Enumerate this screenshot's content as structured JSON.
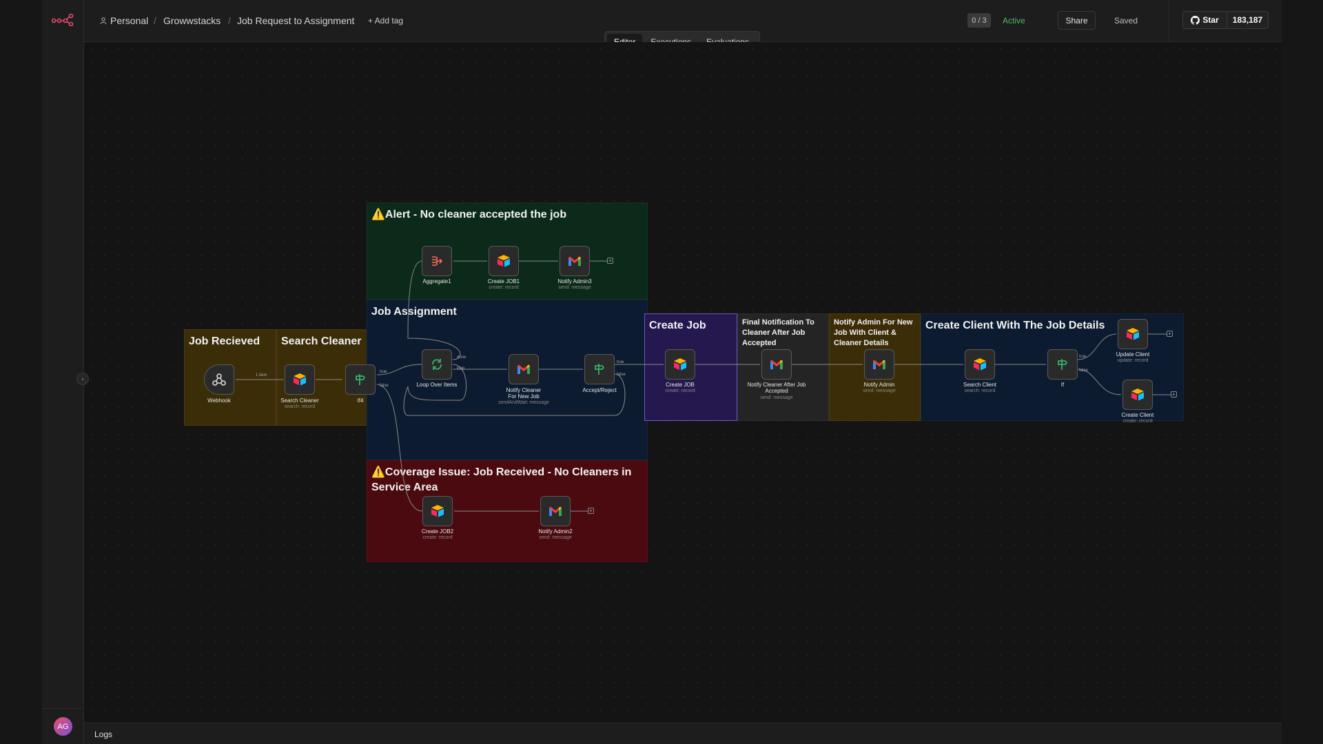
{
  "topbar": {
    "breadcrumb": {
      "personal": "Personal",
      "project": "Growwstacks",
      "workflow": "Job Request to Assignment"
    },
    "add_tag": "+ Add tag",
    "counter": "0 / 3",
    "active": "Active",
    "share": "Share",
    "saved": "Saved",
    "github": {
      "star": "Star",
      "count": "183,187"
    }
  },
  "tabs": {
    "editor": "Editor",
    "executions": "Executions",
    "evaluations": "Evaluations"
  },
  "sidebar": {
    "avatar": "AG"
  },
  "logs": "Logs",
  "colors": {
    "accent": "#ea4b71",
    "active": "#4fb96f",
    "airtable": "#2d7ff9",
    "gmail": "#ea4335",
    "if": "#35b36a"
  },
  "stickies": {
    "job_received": "Job Recieved",
    "search_cleaner": "Search Cleaner",
    "alert": "⚠️Alert - No cleaner accepted the job",
    "job_assignment": "Job Assignment",
    "coverage": "⚠️Coverage Issue: Job Received - No Cleaners in Service Area",
    "create_job": "Create Job",
    "final_notification": "Final Notification To Cleaner After Job Accepted",
    "notify_admin": "Notify Admin For New Job With Client & Cleaner Details",
    "create_client": "Create Client With The Job Details"
  },
  "nodes": {
    "webhook": {
      "label": "Webhook"
    },
    "search_cleaner": {
      "label": "Search Cleaner",
      "sub": "search: record"
    },
    "if4": {
      "label": "If4"
    },
    "aggregate1": {
      "label": "Aggregate1"
    },
    "create_job1": {
      "label": "Create JOB1",
      "sub": "create: record"
    },
    "notify_admin3": {
      "label": "Notify Admin3",
      "sub": "send: message"
    },
    "loop": {
      "label": "Loop Over Items"
    },
    "notify_cleaner": {
      "label": "Notify Cleaner For New Job",
      "sub": "sendAndWait: message"
    },
    "accept_reject": {
      "label": "Accept/Reject"
    },
    "create_job": {
      "label": "Create JOB",
      "sub": "create: record"
    },
    "notify_cleaner_after": {
      "label": "Notify Cleaner After Job Accepted",
      "sub": "send: message"
    },
    "notify_admin": {
      "label": "Notify Admin",
      "sub": "send: message"
    },
    "search_client": {
      "label": "Search Client",
      "sub": "search: record"
    },
    "if": {
      "label": "If"
    },
    "update_client": {
      "label": "Update Client",
      "sub": "update: record"
    },
    "create_client": {
      "label": "Create Client",
      "sub": "create: record"
    },
    "create_job2": {
      "label": "Create JOB2",
      "sub": "create: record"
    },
    "notify_admin2": {
      "label": "Notify Admin2",
      "sub": "send: message"
    }
  },
  "edges": {
    "one_item": "1 item",
    "true": "true",
    "false": "false",
    "done": "done",
    "loop": "loop"
  }
}
